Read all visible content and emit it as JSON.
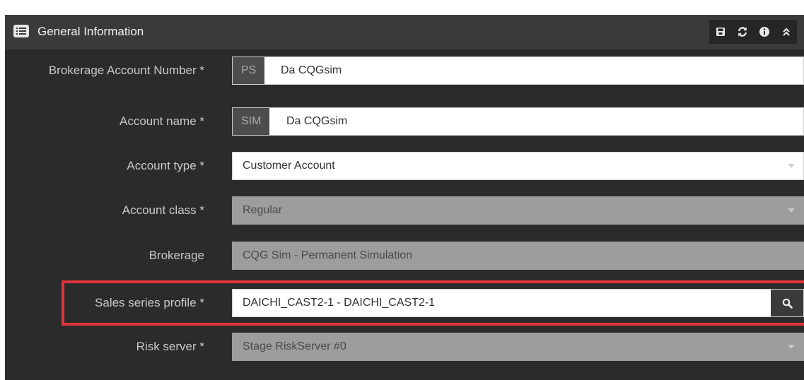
{
  "panel": {
    "title": "General Information",
    "toolbar": [
      {
        "name": "save-icon",
        "title": "Save"
      },
      {
        "name": "refresh-icon",
        "title": "Refresh"
      },
      {
        "name": "info-icon",
        "title": "Info"
      },
      {
        "name": "collapse-icon",
        "title": "Collapse"
      }
    ]
  },
  "form": {
    "brokerage_account_number": {
      "label": "Brokerage Account Number  *",
      "prefix": "PS",
      "value": "Da CQGsim"
    },
    "account_name": {
      "label": "Account name  *",
      "prefix": "SIM",
      "value": "Da CQGsim"
    },
    "account_type": {
      "label": "Account type  *",
      "value": "Customer Account"
    },
    "account_class": {
      "label": "Account class  *",
      "value": "Regular"
    },
    "brokerage": {
      "label": "Brokerage",
      "value": "CQG Sim - Permanent Simulation"
    },
    "sales_series_profile": {
      "label": "Sales series profile  *",
      "value": "DAICHI_CAST2-1 - DAICHI_CAST2-1"
    },
    "risk_server": {
      "label": "Risk server  *",
      "value": "Stage RiskServer #0"
    }
  },
  "colors": {
    "panel_bg": "#2b2b2b",
    "header_bg": "#3a3a3a",
    "highlight": "#e0343c"
  }
}
